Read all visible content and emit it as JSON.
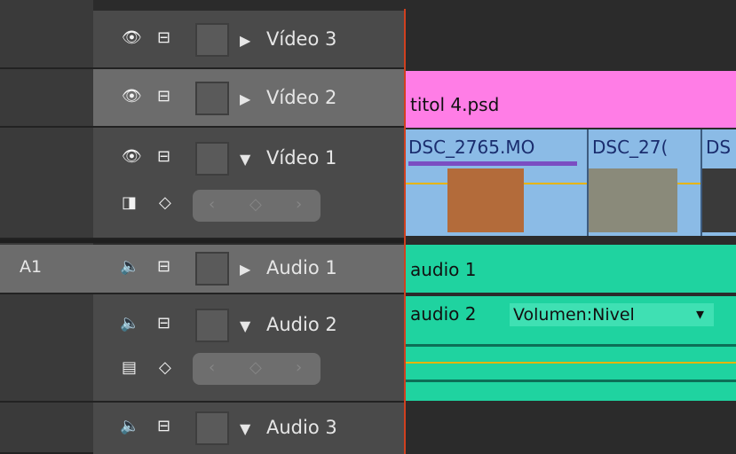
{
  "tracks": {
    "v3": {
      "label": "Vídeo 3",
      "toggle": "▶"
    },
    "v2": {
      "label": "Vídeo 2",
      "toggle": "▶"
    },
    "v1": {
      "label": "Vídeo 1",
      "toggle": "▼"
    },
    "a1": {
      "label": "Audio 1",
      "toggle": "▶",
      "target": "A1"
    },
    "a2": {
      "label": "Audio 2",
      "toggle": "▼"
    },
    "a3": {
      "label": "Audio 3",
      "toggle": "▼"
    }
  },
  "clips": {
    "title": "titol 4.psd",
    "v1_a": "DSC_2765.MO",
    "v1_b": "DSC_27(",
    "v1_c": "DS",
    "audio1": "audio 1",
    "audio2": "audio 2",
    "audio2_dropdown": "Volumen:Nivel",
    "audio2_arrow": "▾"
  },
  "colors": {
    "title_clip": "#ff7de6",
    "video_clip": "#8bbbe6",
    "audio_clip": "#1fd3a0",
    "playhead": "#d0401f"
  }
}
